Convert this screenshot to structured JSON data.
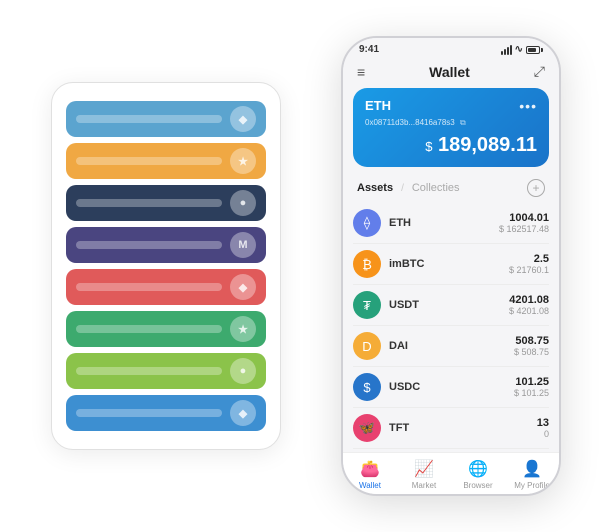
{
  "scene": {
    "background_color": "#ffffff"
  },
  "card_stack": {
    "cards": [
      {
        "color": "#5BA4CF",
        "icon": "◆",
        "label": "blue-card"
      },
      {
        "color": "#F0A843",
        "icon": "★",
        "label": "orange-card"
      },
      {
        "color": "#2C3E5C",
        "icon": "●",
        "label": "dark-card"
      },
      {
        "color": "#4A4580",
        "icon": "M",
        "label": "purple-card"
      },
      {
        "color": "#E05A5A",
        "icon": "◆",
        "label": "red-card"
      },
      {
        "color": "#3DAA6E",
        "icon": "★",
        "label": "green-card"
      },
      {
        "color": "#8BC34A",
        "icon": "●",
        "label": "lightgreen-card"
      },
      {
        "color": "#3D8FD1",
        "icon": "◆",
        "label": "blue2-card"
      }
    ]
  },
  "phone": {
    "status_bar": {
      "time": "9:41",
      "signal": "▲▲▲",
      "wifi": "WiFi",
      "battery": "BT"
    },
    "header": {
      "menu_icon": "≡",
      "title": "Wallet",
      "expand_icon": "⤢"
    },
    "eth_card": {
      "label": "ETH",
      "address": "0x08711d3b...8416a78s3",
      "copy_icon": "⧉",
      "more_icon": "•••",
      "balance_prefix": "$",
      "balance": "189,089.11"
    },
    "assets_section": {
      "tab_active": "Assets",
      "divider": "/",
      "tab_inactive": "Collecties",
      "add_icon": "+"
    },
    "assets": [
      {
        "name": "ETH",
        "icon_type": "eth",
        "icon_color": "#627EEA",
        "amount": "1004.01",
        "usd": "$ 162517.48"
      },
      {
        "name": "imBTC",
        "icon_type": "imbtc",
        "icon_color": "#F7931A",
        "amount": "2.5",
        "usd": "$ 21760.1"
      },
      {
        "name": "USDT",
        "icon_type": "usdt",
        "icon_color": "#26A17B",
        "amount": "4201.08",
        "usd": "$ 4201.08"
      },
      {
        "name": "DAI",
        "icon_type": "dai",
        "icon_color": "#F5AC37",
        "amount": "508.75",
        "usd": "$ 508.75"
      },
      {
        "name": "USDC",
        "icon_type": "usdc",
        "icon_color": "#2775CA",
        "amount": "101.25",
        "usd": "$ 101.25"
      },
      {
        "name": "TFT",
        "icon_type": "tft",
        "icon_color": "#E8416F",
        "amount": "13",
        "usd": "0"
      }
    ],
    "nav": [
      {
        "icon": "👛",
        "label": "Wallet",
        "active": true
      },
      {
        "icon": "📈",
        "label": "Market",
        "active": false
      },
      {
        "icon": "🌐",
        "label": "Browser",
        "active": false
      },
      {
        "icon": "👤",
        "label": "My Profile",
        "active": false
      }
    ]
  }
}
